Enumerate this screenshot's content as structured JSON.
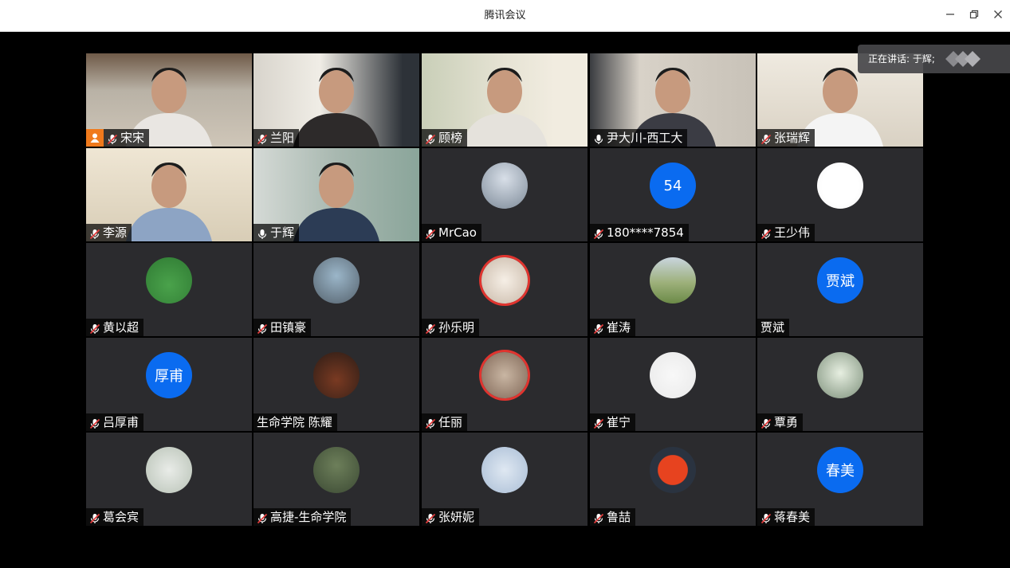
{
  "window": {
    "title": "腾讯会议"
  },
  "speaking": {
    "text": "正在讲话: 于辉;"
  },
  "participants": [
    {
      "name": "宋宋",
      "kind": "video",
      "host": true
    },
    {
      "name": "兰阳",
      "kind": "video"
    },
    {
      "name": "顾榜",
      "kind": "video"
    },
    {
      "name": "尹大川-西工大",
      "kind": "video",
      "mic_on": true
    },
    {
      "name": "张瑞辉",
      "kind": "video"
    },
    {
      "name": "李源",
      "kind": "video"
    },
    {
      "name": "于辉",
      "kind": "video",
      "mic_on": true,
      "speaking": true
    },
    {
      "name": "MrCao",
      "kind": "avatar-photo"
    },
    {
      "name": "180****7854",
      "kind": "avatar-text",
      "avatar_text": "54"
    },
    {
      "name": "王少伟",
      "kind": "avatar-photo"
    },
    {
      "name": "黄以超",
      "kind": "avatar-photo"
    },
    {
      "name": "田镇豪",
      "kind": "avatar-photo"
    },
    {
      "name": "孙乐明",
      "kind": "avatar-photo"
    },
    {
      "name": "崔涛",
      "kind": "avatar-photo"
    },
    {
      "name": "贾斌",
      "kind": "avatar-text",
      "avatar_text": "贾斌",
      "no_mic": true
    },
    {
      "name": "吕厚甫",
      "kind": "avatar-text",
      "avatar_text": "厚甫"
    },
    {
      "name": "生命学院 陈耀",
      "kind": "avatar-photo",
      "no_mic": true
    },
    {
      "name": "任丽",
      "kind": "avatar-photo"
    },
    {
      "name": "崔宁",
      "kind": "avatar-photo"
    },
    {
      "name": "覃勇",
      "kind": "avatar-photo"
    },
    {
      "name": "葛会宾",
      "kind": "avatar-photo"
    },
    {
      "name": "高捷-生命学院",
      "kind": "avatar-photo"
    },
    {
      "name": "张妍妮",
      "kind": "avatar-photo"
    },
    {
      "name": "鲁喆",
      "kind": "avatar-photo"
    },
    {
      "name": "蒋春美",
      "kind": "avatar-text",
      "avatar_text": "春美"
    }
  ]
}
